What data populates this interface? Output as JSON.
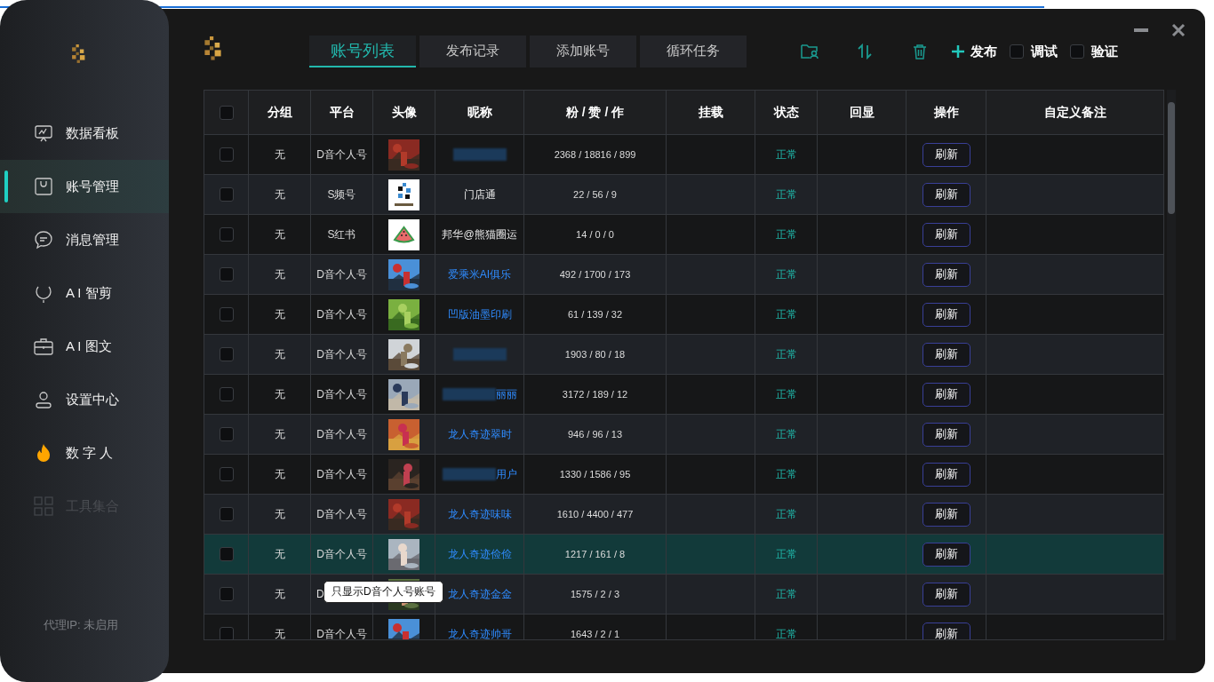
{
  "sidebar": {
    "items": [
      {
        "label": "数据看板",
        "selected": false,
        "disabled": false
      },
      {
        "label": "账号管理",
        "selected": true,
        "disabled": false
      },
      {
        "label": "消息管理",
        "selected": false,
        "disabled": false
      },
      {
        "label": "A I 智剪",
        "selected": false,
        "disabled": false
      },
      {
        "label": "A I 图文",
        "selected": false,
        "disabled": false
      },
      {
        "label": "设置中心",
        "selected": false,
        "disabled": false
      },
      {
        "label": "数 字 人",
        "selected": false,
        "disabled": false
      },
      {
        "label": "工具集合",
        "selected": false,
        "disabled": true
      }
    ],
    "footer": "代理IP: 未启用"
  },
  "tabs": [
    {
      "label": "账号列表",
      "selected": true
    },
    {
      "label": "发布记录",
      "selected": false
    },
    {
      "label": "添加账号",
      "selected": false
    },
    {
      "label": "循环任务",
      "selected": false
    }
  ],
  "toolbar": {
    "publish": "发布",
    "checks": [
      {
        "label": "调试",
        "checked": false
      },
      {
        "label": "验证",
        "checked": false
      }
    ]
  },
  "table": {
    "all_checked": false,
    "columns": [
      "分组",
      "平台",
      "头像",
      "昵称",
      "粉 / 赞 / 作",
      "挂载",
      "状态",
      "回显",
      "操作",
      "自定义备注"
    ],
    "rows": [
      {
        "checked": false,
        "group": "无",
        "platform": "D音个人号",
        "redacted": true,
        "linked": true,
        "stats": "2368 / 18816 / 899",
        "status": "正常",
        "action": "刷新",
        "hovered": false
      },
      {
        "checked": false,
        "group": "无",
        "platform": "S频号",
        "avatar": {
          "kind": "logo"
        },
        "nickname": "门店通",
        "redacted": false,
        "linked": false,
        "stats": "22 / 56 / 9",
        "status": "正常",
        "action": "刷新",
        "hovered": false
      },
      {
        "checked": false,
        "group": "无",
        "platform": "S红书",
        "avatar": {
          "kind": "watermelon"
        },
        "nickname": "邦华@熊猫圈运",
        "redacted": false,
        "linked": false,
        "stats": "14 / 0 / 0",
        "status": "正常",
        "action": "刷新",
        "hovered": false
      },
      {
        "checked": false,
        "group": "无",
        "platform": "D音个人号",
        "nickname": "爱乘米AI俱乐",
        "redacted": false,
        "linked": true,
        "stats": "492 / 1700 / 173",
        "status": "正常",
        "action": "刷新",
        "hovered": false
      },
      {
        "checked": false,
        "group": "无",
        "platform": "D音个人号",
        "nickname": "凹版油墨印刷",
        "redacted": false,
        "linked": true,
        "stats": "61 / 139 / 32",
        "status": "正常",
        "action": "刷新",
        "hovered": false
      },
      {
        "checked": false,
        "group": "无",
        "platform": "D音个人号",
        "redacted": true,
        "linked": true,
        "stats": "1903 / 80 / 18",
        "status": "正常",
        "action": "刷新",
        "hovered": false
      },
      {
        "checked": false,
        "group": "无",
        "platform": "D音个人号",
        "nickname": "丽丽",
        "redacted": true,
        "linked": true,
        "stats": "3172 / 189 / 12",
        "status": "正常",
        "action": "刷新",
        "hovered": false
      },
      {
        "checked": false,
        "group": "无",
        "platform": "D音个人号",
        "nickname": "龙人奇迹翠时",
        "redacted": false,
        "linked": true,
        "stats": "946 / 96 / 13",
        "status": "正常",
        "action": "刷新",
        "hovered": false
      },
      {
        "checked": false,
        "group": "无",
        "platform": "D音个人号",
        "nickname": "用户",
        "redacted": true,
        "linked": true,
        "stats": "1330 / 1586 / 95",
        "status": "正常",
        "action": "刷新",
        "hovered": false
      },
      {
        "checked": false,
        "group": "无",
        "platform": "D音个人号",
        "nickname": "龙人奇迹味味",
        "redacted": false,
        "linked": true,
        "stats": "1610 / 4400 / 477",
        "status": "正常",
        "action": "刷新",
        "hovered": false
      },
      {
        "checked": false,
        "group": "无",
        "platform": "D音个人号",
        "nickname": "龙人奇迹俭俭",
        "redacted": false,
        "linked": true,
        "stats": "1217 / 161 / 8",
        "status": "正常",
        "action": "刷新",
        "hovered": true
      },
      {
        "checked": false,
        "group": "无",
        "platform": "D",
        "nickname": "龙人奇迹金金",
        "redacted": false,
        "linked": true,
        "stats": "1575 / 2 / 3",
        "status": "正常",
        "action": "刷新",
        "hovered": false,
        "tooltip": "只显示D音个人号账号"
      },
      {
        "checked": false,
        "group": "无",
        "platform": "D音个人号",
        "nickname": "龙人奇迹帅哥",
        "redacted": false,
        "linked": true,
        "stats": "1643 / 2 / 1",
        "status": "正常",
        "action": "刷新",
        "hovered": false
      }
    ]
  }
}
